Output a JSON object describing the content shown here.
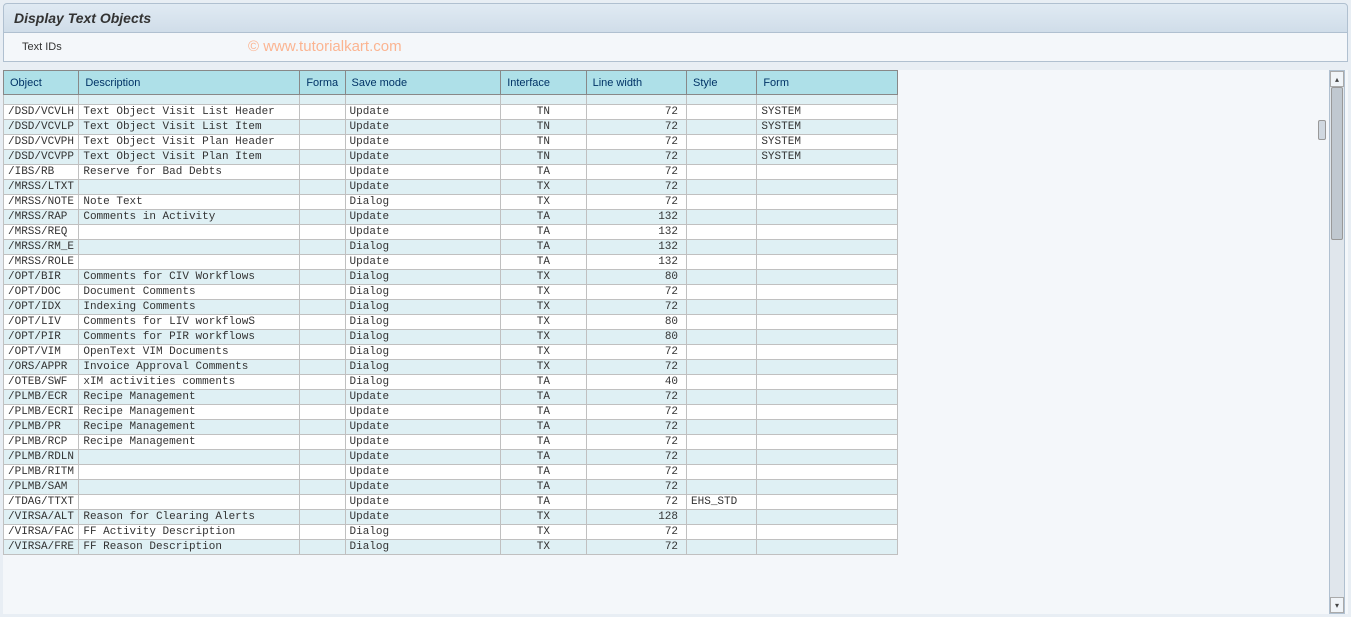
{
  "title": "Display Text Objects",
  "toolbar": {
    "text_ids_label": "Text IDs"
  },
  "watermark": "© www.tutorialkart.com",
  "table": {
    "headers": {
      "object": "Object",
      "description": "Description",
      "format": "Forma",
      "savemode": "Save mode",
      "interface": "Interface",
      "linewidth": "Line width",
      "style": "Style",
      "form": "Form"
    },
    "rows": [
      {
        "object": "/DSD/VCVLH",
        "description": "Text Object Visit List Header",
        "format": "",
        "savemode": "Update",
        "interface": "TN",
        "linewidth": "72",
        "style": "",
        "form": "SYSTEM"
      },
      {
        "object": "/DSD/VCVLP",
        "description": "Text Object Visit List Item",
        "format": "",
        "savemode": "Update",
        "interface": "TN",
        "linewidth": "72",
        "style": "",
        "form": "SYSTEM"
      },
      {
        "object": "/DSD/VCVPH",
        "description": "Text Object Visit Plan Header",
        "format": "",
        "savemode": "Update",
        "interface": "TN",
        "linewidth": "72",
        "style": "",
        "form": "SYSTEM"
      },
      {
        "object": "/DSD/VCVPP",
        "description": "Text Object Visit Plan Item",
        "format": "",
        "savemode": "Update",
        "interface": "TN",
        "linewidth": "72",
        "style": "",
        "form": "SYSTEM"
      },
      {
        "object": "/IBS/RB",
        "description": "Reserve for Bad Debts",
        "format": "",
        "savemode": "Update",
        "interface": "TA",
        "linewidth": "72",
        "style": "",
        "form": ""
      },
      {
        "object": "/MRSS/LTXT",
        "description": "",
        "format": "",
        "savemode": "Update",
        "interface": "TX",
        "linewidth": "72",
        "style": "",
        "form": ""
      },
      {
        "object": "/MRSS/NOTE",
        "description": "Note Text",
        "format": "",
        "savemode": "Dialog",
        "interface": "TX",
        "linewidth": "72",
        "style": "",
        "form": ""
      },
      {
        "object": "/MRSS/RAP",
        "description": "Comments in Activity",
        "format": "",
        "savemode": "Update",
        "interface": "TA",
        "linewidth": "132",
        "style": "",
        "form": ""
      },
      {
        "object": "/MRSS/REQ",
        "description": "",
        "format": "",
        "savemode": "Update",
        "interface": "TA",
        "linewidth": "132",
        "style": "",
        "form": ""
      },
      {
        "object": "/MRSS/RM_E",
        "description": "",
        "format": "",
        "savemode": "Dialog",
        "interface": "TA",
        "linewidth": "132",
        "style": "",
        "form": ""
      },
      {
        "object": "/MRSS/ROLE",
        "description": "",
        "format": "",
        "savemode": "Update",
        "interface": "TA",
        "linewidth": "132",
        "style": "",
        "form": ""
      },
      {
        "object": "/OPT/BIR",
        "description": "Comments for CIV Workflows",
        "format": "",
        "savemode": "Dialog",
        "interface": "TX",
        "linewidth": "80",
        "style": "",
        "form": ""
      },
      {
        "object": "/OPT/DOC",
        "description": "Document Comments",
        "format": "",
        "savemode": "Dialog",
        "interface": "TX",
        "linewidth": "72",
        "style": "",
        "form": ""
      },
      {
        "object": "/OPT/IDX",
        "description": "Indexing Comments",
        "format": "",
        "savemode": "Dialog",
        "interface": "TX",
        "linewidth": "72",
        "style": "",
        "form": ""
      },
      {
        "object": "/OPT/LIV",
        "description": "Comments for LIV workflowS",
        "format": "",
        "savemode": "Dialog",
        "interface": "TX",
        "linewidth": "80",
        "style": "",
        "form": ""
      },
      {
        "object": "/OPT/PIR",
        "description": "Comments for PIR workflows",
        "format": "",
        "savemode": "Dialog",
        "interface": "TX",
        "linewidth": "80",
        "style": "",
        "form": ""
      },
      {
        "object": "/OPT/VIM",
        "description": "OpenText VIM Documents",
        "format": "",
        "savemode": "Dialog",
        "interface": "TX",
        "linewidth": "72",
        "style": "",
        "form": ""
      },
      {
        "object": "/ORS/APPR",
        "description": "Invoice Approval Comments",
        "format": "",
        "savemode": "Dialog",
        "interface": "TX",
        "linewidth": "72",
        "style": "",
        "form": ""
      },
      {
        "object": "/OTEB/SWF",
        "description": "xIM activities comments",
        "format": "",
        "savemode": "Dialog",
        "interface": "TA",
        "linewidth": "40",
        "style": "",
        "form": ""
      },
      {
        "object": "/PLMB/ECR",
        "description": "Recipe Management",
        "format": "",
        "savemode": "Update",
        "interface": "TA",
        "linewidth": "72",
        "style": "",
        "form": ""
      },
      {
        "object": "/PLMB/ECRI",
        "description": "Recipe Management",
        "format": "",
        "savemode": "Update",
        "interface": "TA",
        "linewidth": "72",
        "style": "",
        "form": ""
      },
      {
        "object": "/PLMB/PR",
        "description": "Recipe Management",
        "format": "",
        "savemode": "Update",
        "interface": "TA",
        "linewidth": "72",
        "style": "",
        "form": ""
      },
      {
        "object": "/PLMB/RCP",
        "description": "Recipe Management",
        "format": "",
        "savemode": "Update",
        "interface": "TA",
        "linewidth": "72",
        "style": "",
        "form": ""
      },
      {
        "object": "/PLMB/RDLN",
        "description": "",
        "format": "",
        "savemode": "Update",
        "interface": "TA",
        "linewidth": "72",
        "style": "",
        "form": ""
      },
      {
        "object": "/PLMB/RITM",
        "description": "",
        "format": "",
        "savemode": "Update",
        "interface": "TA",
        "linewidth": "72",
        "style": "",
        "form": ""
      },
      {
        "object": "/PLMB/SAM",
        "description": "",
        "format": "",
        "savemode": "Update",
        "interface": "TA",
        "linewidth": "72",
        "style": "",
        "form": ""
      },
      {
        "object": "/TDAG/TTXT",
        "description": "",
        "format": "",
        "savemode": "Update",
        "interface": "TA",
        "linewidth": "72",
        "style": "EHS_STD",
        "form": ""
      },
      {
        "object": "/VIRSA/ALT",
        "description": "Reason for Clearing Alerts",
        "format": "",
        "savemode": "Update",
        "interface": "TX",
        "linewidth": "128",
        "style": "",
        "form": ""
      },
      {
        "object": "/VIRSA/FAC",
        "description": "FF Activity Description",
        "format": "",
        "savemode": "Dialog",
        "interface": "TX",
        "linewidth": "72",
        "style": "",
        "form": ""
      },
      {
        "object": "/VIRSA/FRE",
        "description": "FF Reason Description",
        "format": "",
        "savemode": "Dialog",
        "interface": "TX",
        "linewidth": "72",
        "style": "",
        "form": ""
      }
    ]
  }
}
